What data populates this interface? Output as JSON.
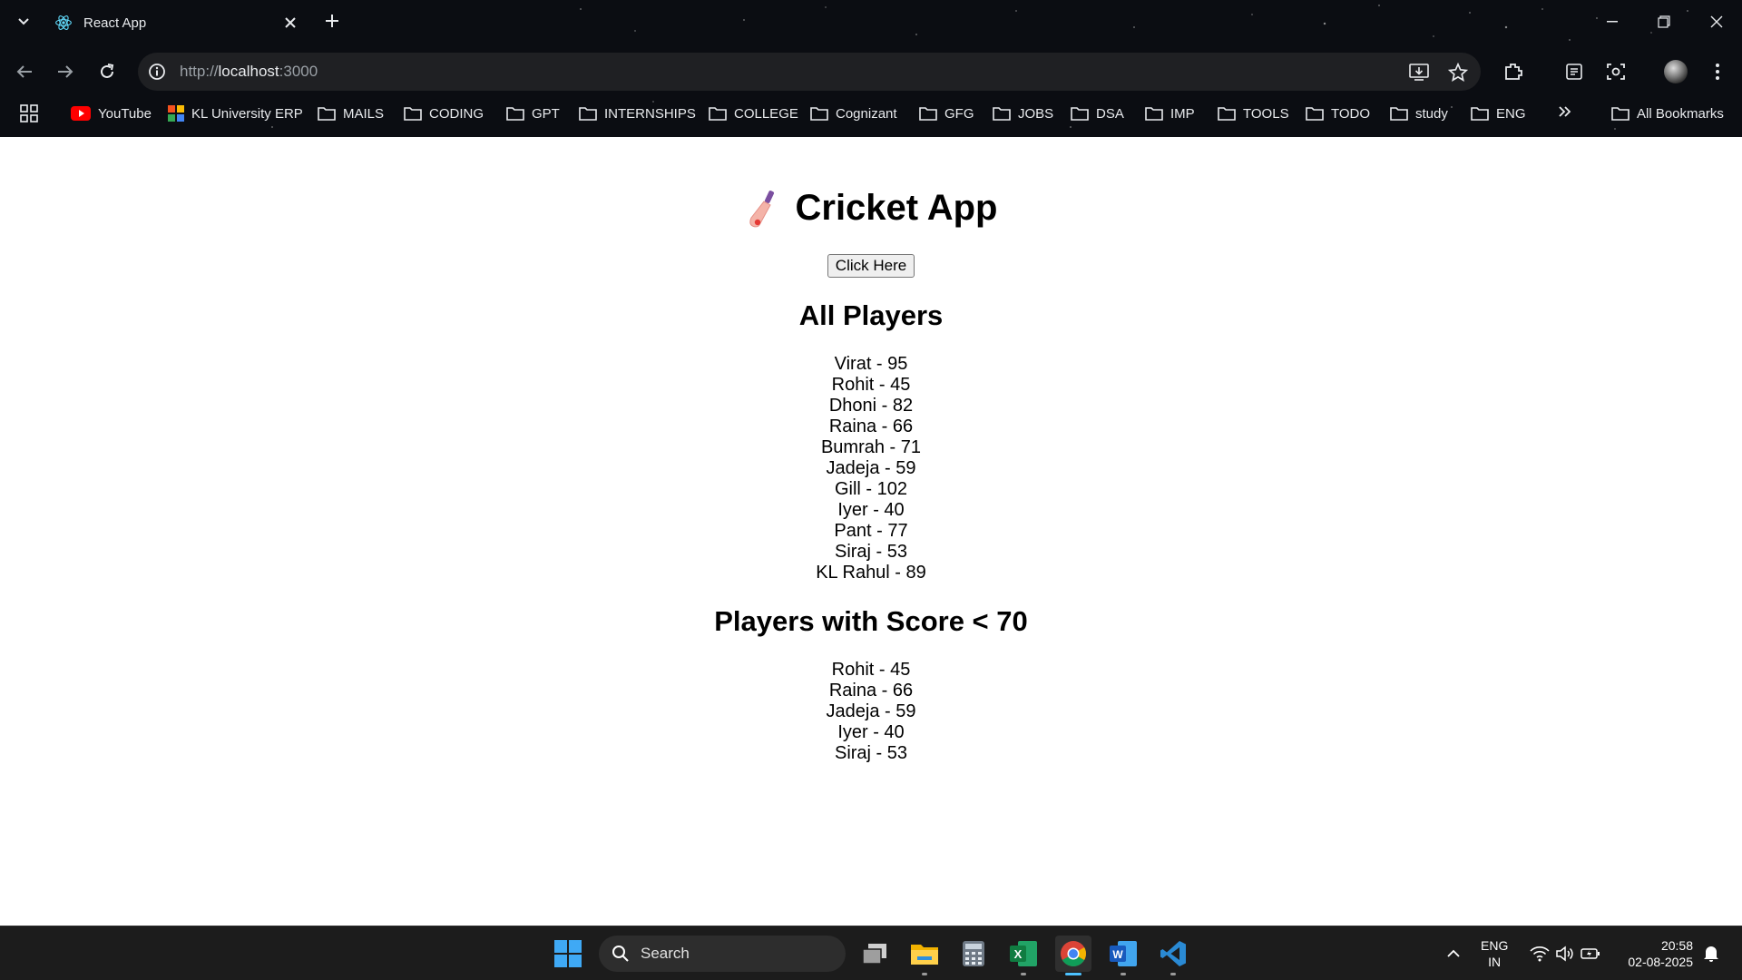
{
  "browser": {
    "tab_title": "React App",
    "url_scheme": "http://",
    "url_host": "localhost",
    "url_port": ":3000",
    "bookmarks": [
      {
        "label": "YouTube",
        "icon": "youtube-icon"
      },
      {
        "label": "KL University ERP",
        "icon": "kl-erp-icon"
      },
      {
        "label": "MAILS",
        "icon": "folder-icon"
      },
      {
        "label": "CODING",
        "icon": "folder-icon"
      },
      {
        "label": "GPT",
        "icon": "folder-icon"
      },
      {
        "label": "INTERNSHIPS",
        "icon": "folder-icon"
      },
      {
        "label": "COLLEGE",
        "icon": "folder-icon"
      },
      {
        "label": "Cognizant",
        "icon": "folder-icon"
      },
      {
        "label": "GFG",
        "icon": "folder-icon"
      },
      {
        "label": "JOBS",
        "icon": "folder-icon"
      },
      {
        "label": "DSA",
        "icon": "folder-icon"
      },
      {
        "label": "IMP",
        "icon": "folder-icon"
      },
      {
        "label": "TOOLS",
        "icon": "folder-icon"
      },
      {
        "label": "TODO",
        "icon": "folder-icon"
      },
      {
        "label": "study",
        "icon": "folder-icon"
      },
      {
        "label": "ENG",
        "icon": "folder-icon"
      }
    ],
    "all_bookmarks_label": "All Bookmarks"
  },
  "app": {
    "title": "Cricket App",
    "button_label": "Click Here",
    "all_players_heading": "All Players",
    "all_players": [
      "Virat - 95",
      "Rohit - 45",
      "Dhoni - 82",
      "Raina - 66",
      "Bumrah - 71",
      "Jadeja - 59",
      "Gill - 102",
      "Iyer - 40",
      "Pant - 77",
      "Siraj - 53",
      "KL Rahul - 89"
    ],
    "filtered_heading": "Players with Score < 70",
    "filtered_players": [
      "Rohit - 45",
      "Raina - 66",
      "Jadeja - 59",
      "Iyer - 40",
      "Siraj - 53"
    ]
  },
  "taskbar": {
    "search_label": "Search",
    "lang_line1": "ENG",
    "lang_line2": "IN",
    "time": "20:58",
    "date": "02-08-2025",
    "accent_color": "#4cc2ff"
  }
}
